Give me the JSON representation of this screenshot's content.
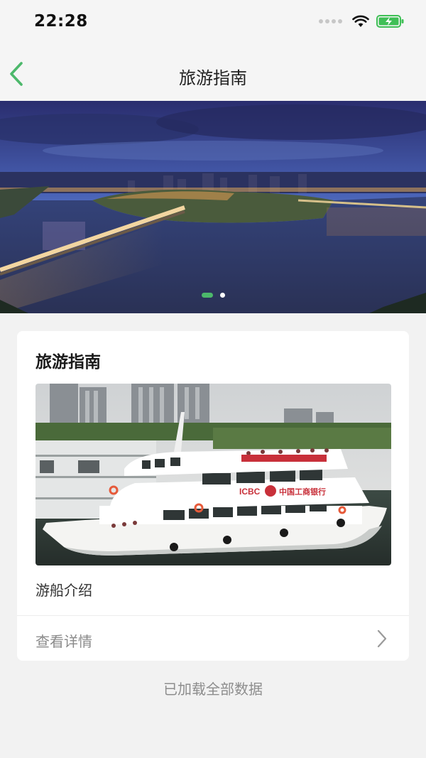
{
  "status": {
    "time": "22:28"
  },
  "nav": {
    "title": "旅游指南"
  },
  "banner": {
    "slide_count": 2,
    "active_index": 0
  },
  "card": {
    "title": "旅游指南",
    "caption": "游船介绍",
    "detail_label": "查看详情",
    "boat_sign": "中国工商银行",
    "boat_brand": "ICBC"
  },
  "footer": {
    "text": "已加载全部数据"
  },
  "colors": {
    "accent": "#4cb86b",
    "battery": "#3fbf56"
  }
}
